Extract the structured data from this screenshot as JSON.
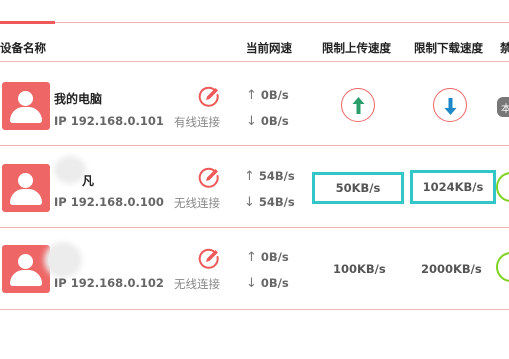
{
  "header": {
    "device_name": "设备名称",
    "current_speed": "当前网速",
    "limit_upload": "限制上传速度",
    "limit_download": "限制下载速度",
    "truncated": "禁"
  },
  "devices": [
    {
      "name": "我的电脑",
      "ip": "IP 192.168.0.101",
      "connection": "有线连接",
      "up_speed": "0B/s",
      "down_speed": "0B/s",
      "status_pill": "本"
    },
    {
      "name": "凡",
      "ip": "IP 192.168.0.100",
      "connection": "无线连接",
      "up_speed": "54B/s",
      "down_speed": "54B/s",
      "limit_upload": "50KB/s",
      "limit_download": "1024KB/s"
    },
    {
      "name": "",
      "ip": "IP 192.168.0.102",
      "connection": "无线连接",
      "up_speed": "0B/s",
      "down_speed": "0B/s",
      "limit_upload": "100KB/s",
      "limit_download": "2000KB/s"
    }
  ],
  "arrows": {
    "up": "↑",
    "down": "↓"
  },
  "colors": {
    "accent": "#ee5a5a",
    "avatar": "#ee6666",
    "highlight": "#33c6c9",
    "green": "#7ed321",
    "up_arrow": "#2a9d6a",
    "down_arrow": "#1e88c8"
  }
}
